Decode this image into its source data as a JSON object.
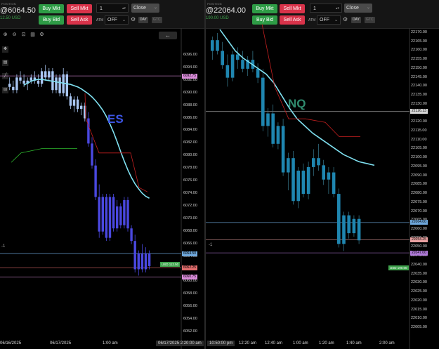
{
  "panes": [
    {
      "id": "es",
      "position_label": "POSITION",
      "price_display": "@6064.50",
      "pnl": "12.50 USD",
      "buttons": {
        "buy_mkt": "Buy Mkt",
        "sell_mkt": "Sell Mkt",
        "buy_bid": "Buy Bid",
        "sell_ask": "Sell Ask",
        "close": "Close"
      },
      "qty": "1",
      "atm_label": "ATM",
      "atm_value": "OFF",
      "day_tag": "DAY",
      "gtc_tag": "GTC",
      "title": "ES",
      "title_color": "#3c55e6",
      "price_scale": [
        "6096.00",
        "6094.00",
        "6092.00",
        "6090.00",
        "6088.00",
        "6086.00",
        "6084.00",
        "6082.00",
        "6080.00",
        "6078.00",
        "6076.00",
        "6074.00",
        "6072.00",
        "6070.00",
        "6068.00",
        "6066.00",
        "6064.00",
        "6062.00",
        "6060.00",
        "6058.00",
        "6056.00",
        "6054.00",
        "6052.00"
      ],
      "price_labels": [
        {
          "text": "6092.75",
          "color": "#d98bd9"
        },
        {
          "text": "6064.50",
          "color": "#6fa8dc"
        },
        {
          "text": "6062.25",
          "color": "#e06c6c"
        },
        {
          "text": "6060.75",
          "color": "#d98bd9"
        }
      ],
      "position_tag": "USD 112.50",
      "qty_marker": "-1",
      "time_labels": [
        "06/16/2025",
        "06/17/2025",
        "1:00 am"
      ],
      "crosshair_time": "06/17/2025 2:20:00 am",
      "candle_color": "#4a48e0",
      "candle_color_up": "#a9c6f2"
    },
    {
      "id": "nq",
      "position_label": "POSITION",
      "price_display": "@22064.00",
      "pnl": "190.00 USD",
      "buttons": {
        "buy_mkt": "Buy Mkt",
        "sell_mkt": "Sell Mkt",
        "buy_bid": "Buy Bid",
        "sell_ask": "Sell Ask",
        "close": "Close"
      },
      "qty": "1",
      "atm_label": "ATM",
      "atm_value": "OFF",
      "day_tag": "DAY",
      "gtc_tag": "GTC",
      "title": "NQ",
      "title_color": "#2f8a6e",
      "price_scale": [
        "22170.00",
        "22165.00",
        "22160.00",
        "22155.00",
        "22150.00",
        "22145.00",
        "22140.00",
        "22135.00",
        "22130.00",
        "22125.00",
        "22120.00",
        "22115.00",
        "22110.00",
        "22105.00",
        "22100.00",
        "22095.00",
        "22090.00",
        "22085.00",
        "22080.00",
        "22075.00",
        "22070.00",
        "22065.00",
        "22060.00",
        "22055.00",
        "22050.00",
        "22045.00",
        "22040.00",
        "22035.00",
        "22030.00",
        "22025.00",
        "22020.00",
        "22015.00",
        "22010.00",
        "22005.00"
      ],
      "price_labels": [
        {
          "text": "22126.13",
          "color": "#d8d8d8"
        },
        {
          "text": "22064.00",
          "color": "#6fa8dc"
        },
        {
          "text": "22054.25",
          "color": "#e8a0a0"
        },
        {
          "text": "22047.00",
          "color": "#b07ad9"
        }
      ],
      "position_tag": "USD 190.00",
      "qty_marker": "-1",
      "time_labels": [
        "10:50:00 pm",
        "12:20 am",
        "12:40 am",
        "1:00 am",
        "1:20 am",
        "1:40 am",
        "2:00 am"
      ],
      "candle_color": "#1f86b0"
    }
  ],
  "toolbar_icons": [
    "zoom-in-icon",
    "zoom-out-icon",
    "reset-zoom-icon",
    "candles-icon",
    "settings-icon",
    "back-arrow-icon"
  ],
  "chart_data": [
    {
      "type": "candlestick",
      "title": "ES",
      "ylim": [
        6050,
        6098
      ],
      "candles": [
        [
          6091.5,
          6092.5,
          6090.5,
          6091.0
        ],
        [
          6091.0,
          6092.0,
          6090.0,
          6090.5
        ],
        [
          6090.5,
          6093.0,
          6090.0,
          6092.5
        ],
        [
          6092.5,
          6093.5,
          6091.5,
          6092.0
        ],
        [
          6092.0,
          6093.0,
          6091.0,
          6091.5
        ],
        [
          6091.5,
          6092.5,
          6090.5,
          6092.0
        ],
        [
          6092.0,
          6093.0,
          6091.5,
          6092.5
        ],
        [
          6092.5,
          6093.5,
          6091.5,
          6092.0
        ],
        [
          6092.0,
          6093.0,
          6091.0,
          6091.5
        ],
        [
          6091.5,
          6094.0,
          6091.0,
          6093.5
        ],
        [
          6093.5,
          6094.5,
          6092.0,
          6092.5
        ],
        [
          6092.5,
          6094.0,
          6092.0,
          6093.5
        ],
        [
          6093.5,
          6094.0,
          6090.0,
          6090.5
        ],
        [
          6090.5,
          6093.0,
          6090.0,
          6092.5
        ],
        [
          6092.5,
          6093.0,
          6089.5,
          6090.0
        ],
        [
          6090.0,
          6094.0,
          6089.5,
          6093.0
        ],
        [
          6093.0,
          6093.5,
          6089.0,
          6089.5
        ],
        [
          6089.5,
          6090.0,
          6087.5,
          6088.0
        ],
        [
          6088.0,
          6089.5,
          6087.0,
          6089.0
        ],
        [
          6089.0,
          6089.5,
          6087.0,
          6087.5
        ],
        [
          6087.5,
          6088.5,
          6086.5,
          6088.0
        ],
        [
          6088.0,
          6088.5,
          6085.5,
          6086.0
        ],
        [
          6086.0,
          6087.0,
          6081.5,
          6082.0
        ],
        [
          6082.0,
          6083.0,
          6078.0,
          6078.5
        ],
        [
          6078.5,
          6079.5,
          6073.0,
          6073.5
        ],
        [
          6073.5,
          6075.5,
          6067.0,
          6068.0
        ],
        [
          6068.0,
          6074.0,
          6067.5,
          6073.5
        ],
        [
          6073.5,
          6074.0,
          6066.5,
          6067.0
        ],
        [
          6067.0,
          6074.0,
          6066.5,
          6073.5
        ],
        [
          6073.5,
          6074.0,
          6068.0,
          6068.5
        ],
        [
          6068.5,
          6073.0,
          6068.0,
          6072.0
        ],
        [
          6072.0,
          6072.5,
          6068.5,
          6069.0
        ],
        [
          6069.0,
          6073.5,
          6068.5,
          6073.0
        ],
        [
          6073.0,
          6073.5,
          6068.0,
          6068.5
        ],
        [
          6068.5,
          6069.0,
          6066.0,
          6066.5
        ],
        [
          6066.5,
          6067.5,
          6061.5,
          6062.0
        ],
        [
          6062.0,
          6065.0,
          6061.0,
          6064.5
        ],
        [
          6064.5,
          6066.0,
          6061.5,
          6062.0
        ],
        [
          6062.0,
          6065.5,
          6061.5,
          6064.5
        ],
        [
          6064.5,
          6065.0,
          6062.0,
          6062.5
        ]
      ],
      "ema": [
        [
          6091.3,
          6091.6,
          6091.9,
          6092.1,
          6092.2,
          6092.2,
          6092.1,
          6092.0,
          6091.9,
          6091.8,
          6091.7,
          6091.6,
          6091.5,
          6091.4,
          6091.2,
          6091.0,
          6090.7,
          6090.3,
          6089.9,
          6089.4,
          6088.8,
          6088.1,
          6087.3,
          6086.3,
          6085.1,
          6083.8,
          6082.3,
          6080.7,
          6079.2,
          6077.8,
          6076.6,
          6075.6,
          6074.8,
          6074.1,
          6073.6,
          6073.3
        ],
        [
          6079.0,
          6079.8,
          6080.3,
          6080.7,
          6081.0,
          6081.2,
          6081.3,
          6081.3
        ]
      ]
    },
    {
      "type": "candlestick",
      "title": "NQ",
      "ylim": [
        22002,
        22172
      ],
      "candles": [
        [
          22160,
          22168,
          22155,
          22166
        ],
        [
          22166,
          22170,
          22158,
          22160
        ],
        [
          22160,
          22165,
          22150,
          22152
        ],
        [
          22152,
          22158,
          22140,
          22145
        ],
        [
          22145,
          22160,
          22143,
          22158
        ],
        [
          22158,
          22162,
          22150,
          22155
        ],
        [
          22155,
          22160,
          22148,
          22150
        ],
        [
          22150,
          22157,
          22146,
          22155
        ],
        [
          22155,
          22160,
          22148,
          22150
        ],
        [
          22150,
          22153,
          22142,
          22145
        ],
        [
          22145,
          22150,
          22115,
          22118
        ],
        [
          22118,
          22128,
          22112,
          22125
        ],
        [
          22125,
          22130,
          22106,
          22108
        ],
        [
          22108,
          22120,
          22105,
          22118
        ],
        [
          22118,
          22122,
          22090,
          22092
        ],
        [
          22092,
          22103,
          22082,
          22100
        ],
        [
          22100,
          22104,
          22074,
          22076
        ],
        [
          22076,
          22095,
          22072,
          22093
        ],
        [
          22093,
          22097,
          22078,
          22080
        ],
        [
          22080,
          22098,
          22077,
          22095
        ],
        [
          22095,
          22105,
          22090,
          22100
        ],
        [
          22100,
          22108,
          22093,
          22096
        ],
        [
          22096,
          22099,
          22085,
          22088
        ],
        [
          22088,
          22095,
          22080,
          22092
        ],
        [
          22092,
          22095,
          22078,
          22080
        ],
        [
          22080,
          22083,
          22050,
          22052
        ],
        [
          22052,
          22070,
          22048,
          22068
        ],
        [
          22068,
          22070,
          22055,
          22058
        ],
        [
          22058,
          22068,
          22056,
          22066
        ],
        [
          22066,
          22068,
          22052,
          22054
        ]
      ]
    }
  ]
}
